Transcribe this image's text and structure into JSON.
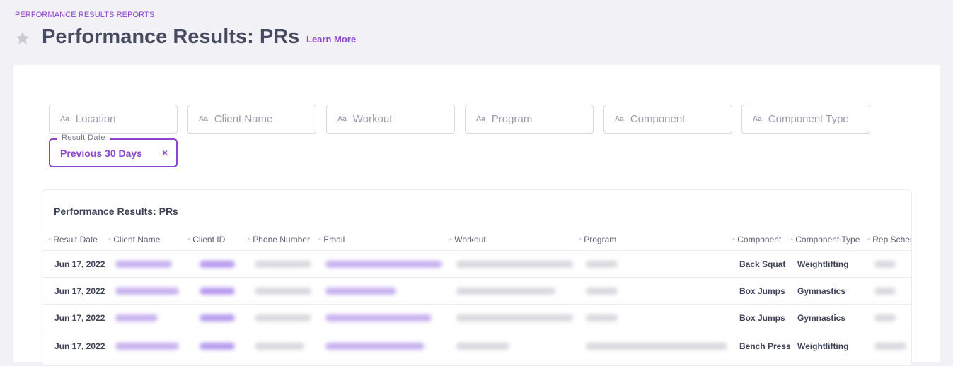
{
  "breadcrumb": "PERFORMANCE RESULTS REPORTS",
  "page": {
    "title": "Performance Results: PRs",
    "learn_more": "Learn More"
  },
  "filters": [
    {
      "icon": "Aa",
      "placeholder": "Location"
    },
    {
      "icon": "Aa",
      "placeholder": "Client Name"
    },
    {
      "icon": "Aa",
      "placeholder": "Workout"
    },
    {
      "icon": "Aa",
      "placeholder": "Program"
    },
    {
      "icon": "Aa",
      "placeholder": "Component"
    },
    {
      "icon": "Aa",
      "placeholder": "Component Type"
    }
  ],
  "date_filter": {
    "label": "Result Date",
    "value": "Previous 30 Days",
    "clear": "×"
  },
  "table": {
    "title": "Performance Results: PRs",
    "columns": [
      "Result Date",
      "Client Name",
      "Client ID",
      "Phone Number",
      "Email",
      "Workout",
      "Program",
      "Component",
      "Component Type",
      "Rep Scher"
    ],
    "rows": [
      {
        "result_date": "Jun 17, 2022",
        "component": "Back Squat",
        "component_type": "Weightlifting"
      },
      {
        "result_date": "Jun 17, 2022",
        "component": "Box Jumps",
        "component_type": "Gymnastics"
      },
      {
        "result_date": "Jun 17, 2022",
        "component": "Box Jumps",
        "component_type": "Gymnastics"
      },
      {
        "result_date": "Jun 17, 2022",
        "component": "Bench Press",
        "component_type": "Weightlifting"
      }
    ]
  },
  "colors": {
    "accent": "#8e44ce",
    "background": "#f2f2f6",
    "text": "#3d4258"
  },
  "icons": {
    "favorite": "star-icon",
    "filter_type": "text-type-icon",
    "sort": "sort-caret-icon"
  }
}
